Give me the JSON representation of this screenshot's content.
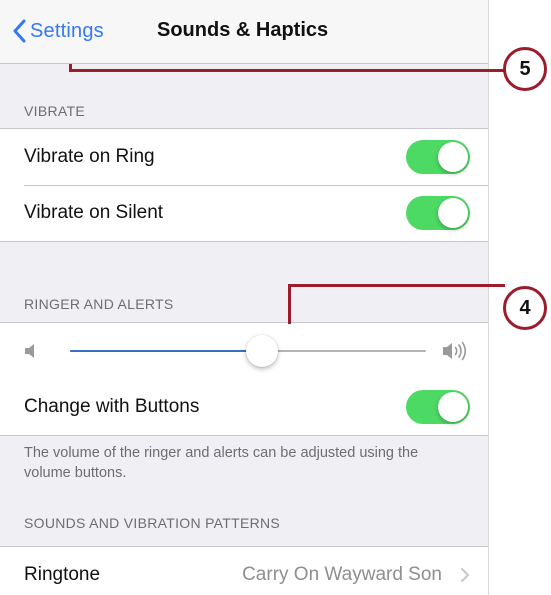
{
  "nav": {
    "back_label": "Settings",
    "title": "Sounds & Haptics"
  },
  "vibrate": {
    "header": "VIBRATE",
    "items": [
      {
        "label": "Vibrate on Ring",
        "on": true
      },
      {
        "label": "Vibrate on Silent",
        "on": true
      }
    ]
  },
  "ringer": {
    "header": "RINGER AND ALERTS",
    "volume_fraction": 0.54,
    "change_with_buttons_label": "Change with Buttons",
    "change_with_buttons_on": true,
    "footer": "The volume of the ringer and alerts can be adjusted using the volume buttons."
  },
  "patterns": {
    "header": "SOUNDS AND VIBRATION PATTERNS",
    "ringtone_label": "Ringtone",
    "ringtone_value": "Carry On Wayward Son"
  },
  "callouts": [
    "5",
    "4"
  ],
  "colors": {
    "accent": "#3478f6",
    "toggle_on": "#4cd964",
    "callout": "#9d1c2b"
  },
  "icons": [
    "chevron-left-icon",
    "speaker-low-icon",
    "speaker-high-icon",
    "chevron-right-icon"
  ]
}
